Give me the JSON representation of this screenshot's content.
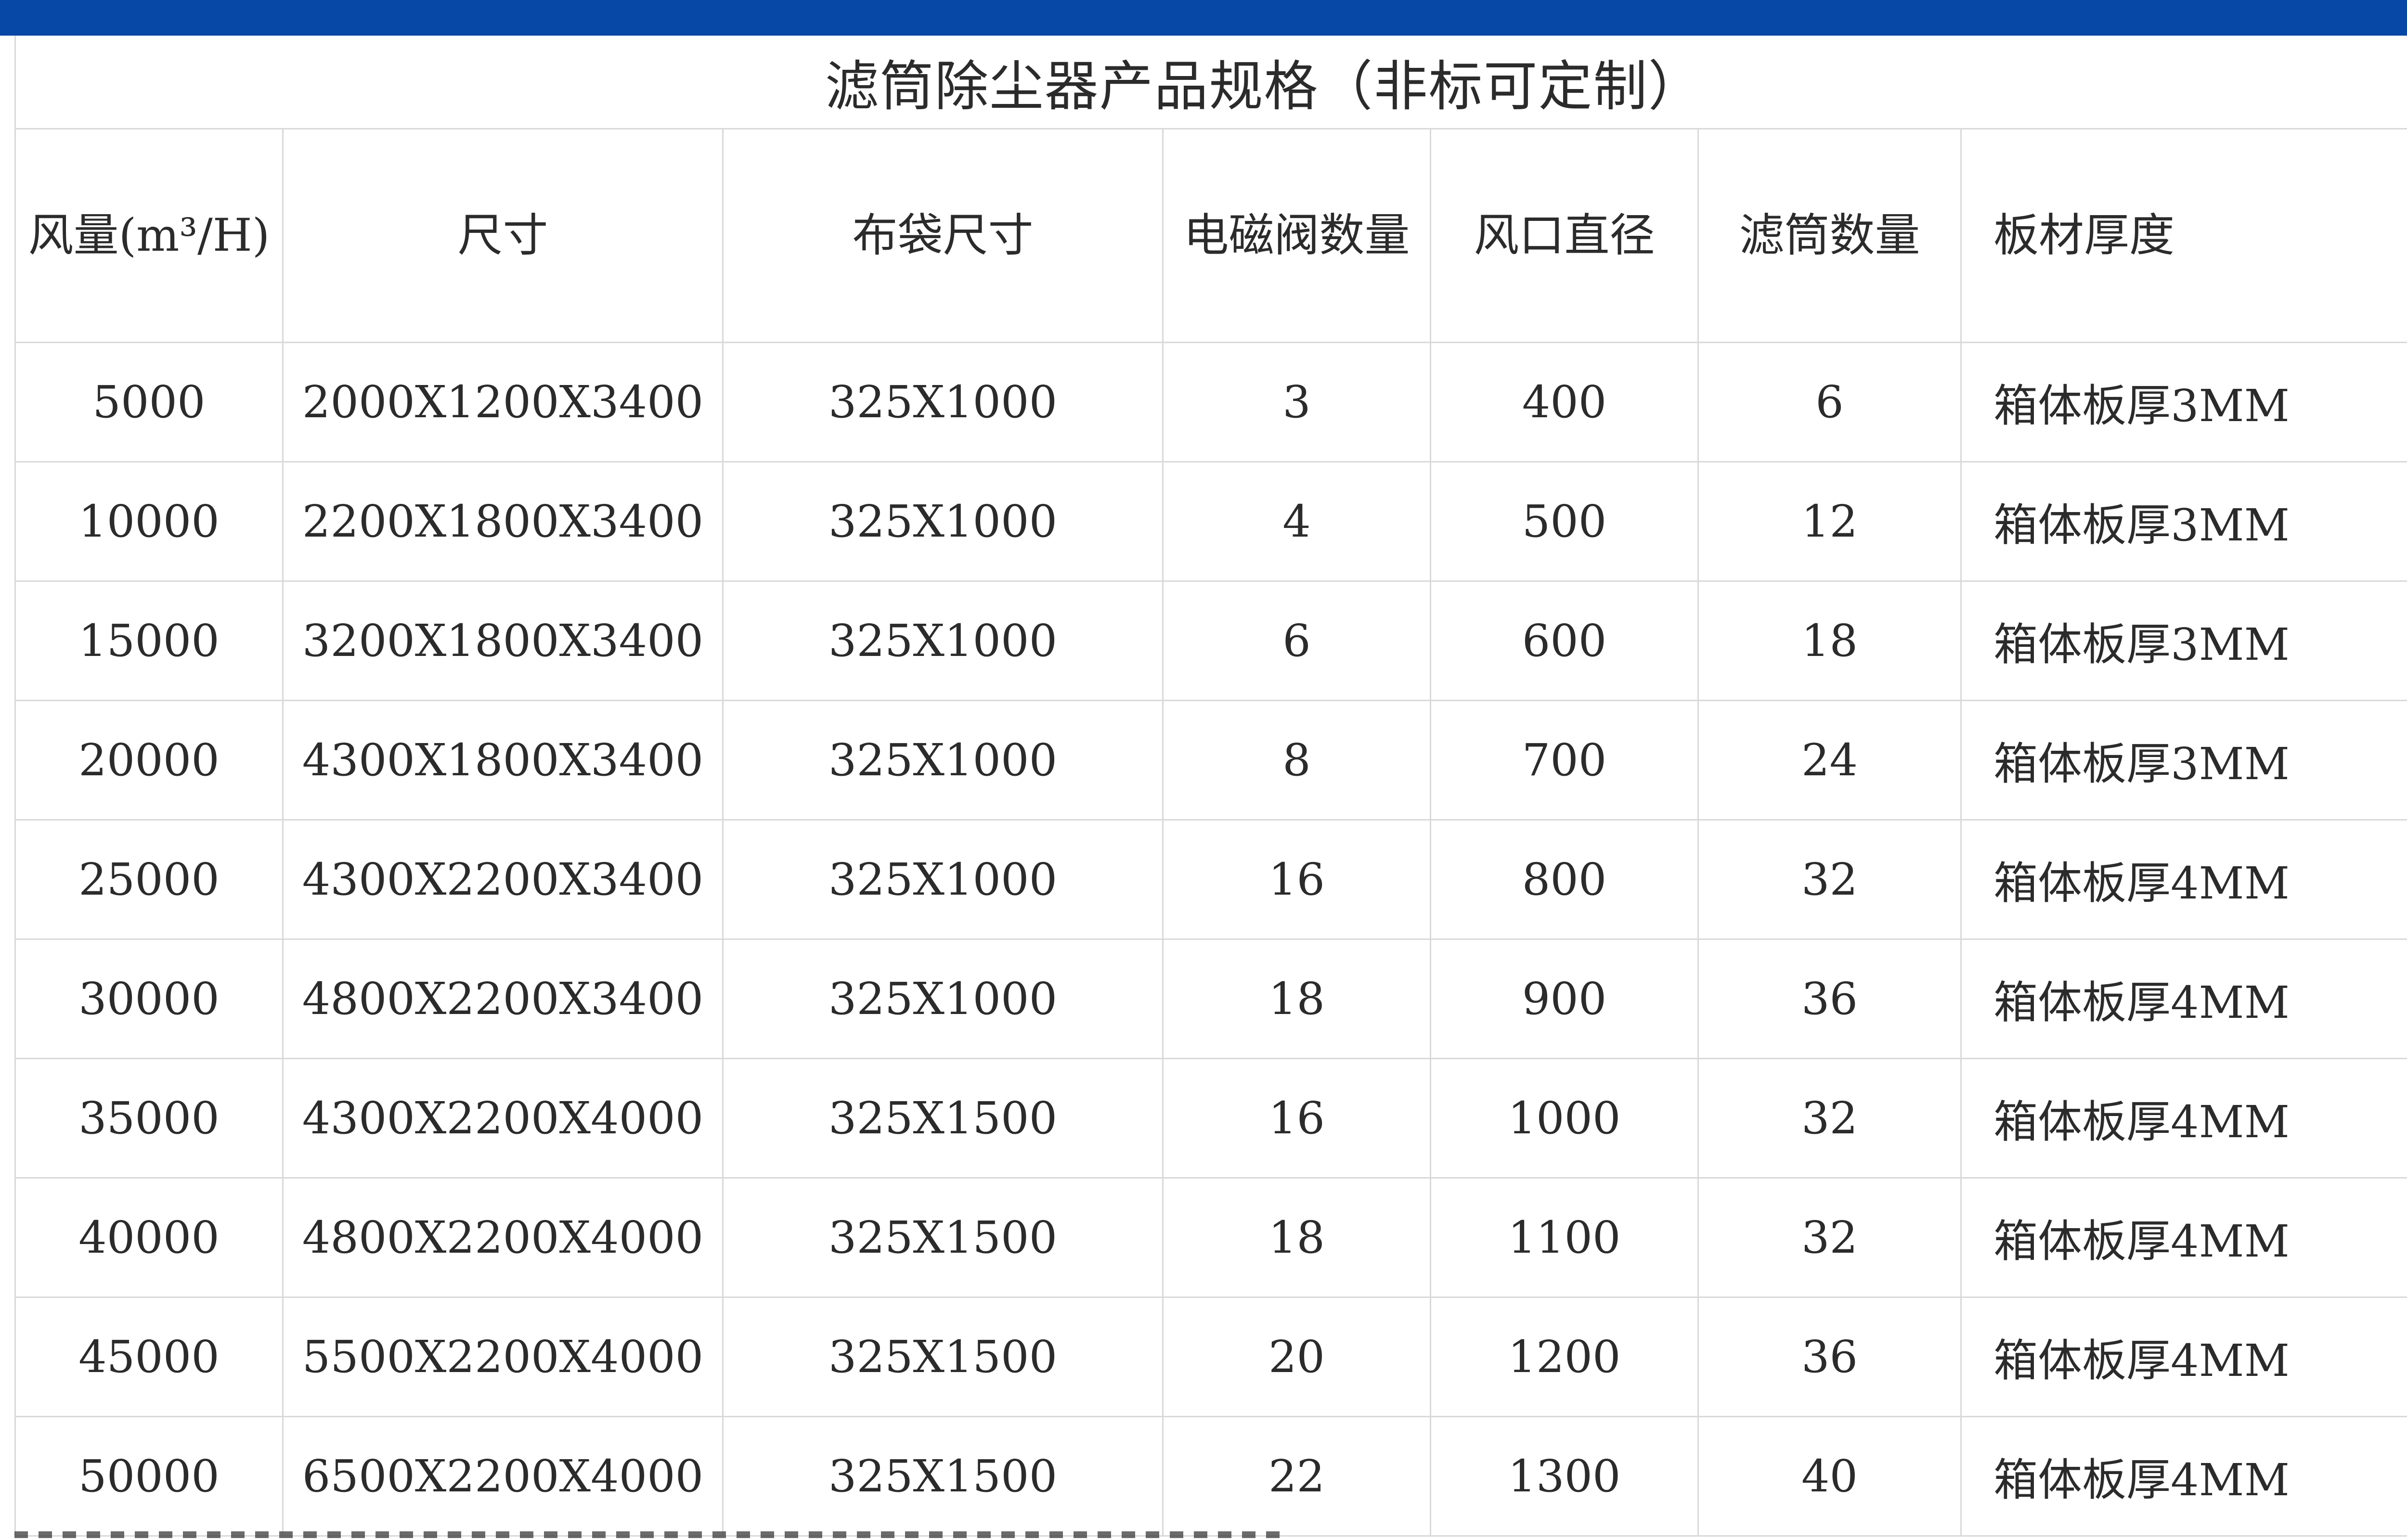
{
  "title": "滤筒除尘器产品规格（非标可定制）",
  "colors": {
    "top_bar": "#0747a6",
    "grid": "#d9d9d9",
    "text": "#2b2b2b"
  },
  "headers": {
    "airflow": "风量(m³/H)",
    "size": "尺寸",
    "bag_size": "布袋尺寸",
    "valve_count": "电磁阀数量",
    "outlet_diameter": "风口直径",
    "filter_count": "滤筒数量",
    "plate_thickness": "板材厚度"
  },
  "rows": [
    {
      "airflow": "5000",
      "size": "2000X1200X3400",
      "bag_size": "325X1000",
      "valve_count": "3",
      "outlet_diameter": "400",
      "filter_count": "6",
      "plate_thickness": "箱体板厚3MM"
    },
    {
      "airflow": "10000",
      "size": "2200X1800X3400",
      "bag_size": "325X1000",
      "valve_count": "4",
      "outlet_diameter": "500",
      "filter_count": "12",
      "plate_thickness": "箱体板厚3MM"
    },
    {
      "airflow": "15000",
      "size": "3200X1800X3400",
      "bag_size": "325X1000",
      "valve_count": "6",
      "outlet_diameter": "600",
      "filter_count": "18",
      "plate_thickness": "箱体板厚3MM"
    },
    {
      "airflow": "20000",
      "size": "4300X1800X3400",
      "bag_size": "325X1000",
      "valve_count": "8",
      "outlet_diameter": "700",
      "filter_count": "24",
      "plate_thickness": "箱体板厚3MM"
    },
    {
      "airflow": "25000",
      "size": "4300X2200X3400",
      "bag_size": "325X1000",
      "valve_count": "16",
      "outlet_diameter": "800",
      "filter_count": "32",
      "plate_thickness": "箱体板厚4MM"
    },
    {
      "airflow": "30000",
      "size": "4800X2200X3400",
      "bag_size": "325X1000",
      "valve_count": "18",
      "outlet_diameter": "900",
      "filter_count": "36",
      "plate_thickness": "箱体板厚4MM"
    },
    {
      "airflow": "35000",
      "size": "4300X2200X4000",
      "bag_size": "325X1500",
      "valve_count": "16",
      "outlet_diameter": "1000",
      "filter_count": "32",
      "plate_thickness": "箱体板厚4MM"
    },
    {
      "airflow": "40000",
      "size": "4800X2200X4000",
      "bag_size": "325X1500",
      "valve_count": "18",
      "outlet_diameter": "1100",
      "filter_count": "32",
      "plate_thickness": "箱体板厚4MM"
    },
    {
      "airflow": "45000",
      "size": "5500X2200X4000",
      "bag_size": "325X1500",
      "valve_count": "20",
      "outlet_diameter": "1200",
      "filter_count": "36",
      "plate_thickness": "箱体板厚4MM"
    },
    {
      "airflow": "50000",
      "size": "6500X2200X4000",
      "bag_size": "325X1500",
      "valve_count": "22",
      "outlet_diameter": "1300",
      "filter_count": "40",
      "plate_thickness": "箱体板厚4MM"
    }
  ]
}
